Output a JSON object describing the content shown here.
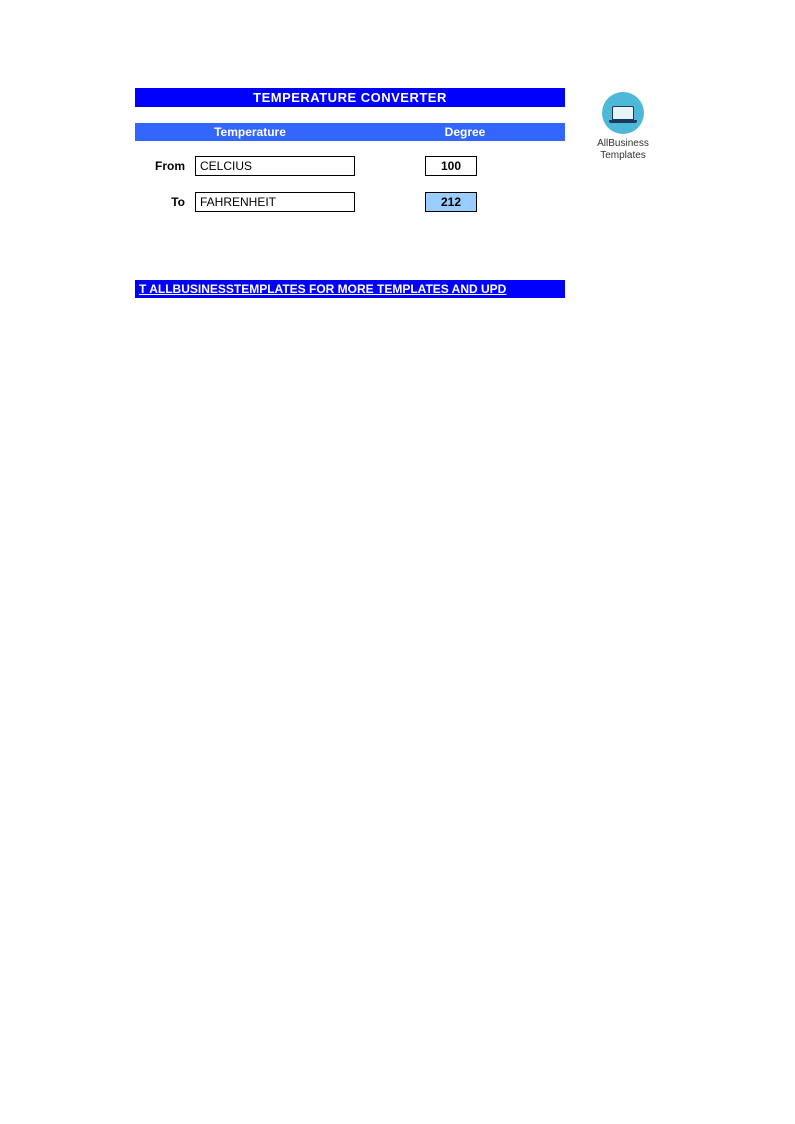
{
  "title": "TEMPERATURE CONVERTER",
  "headers": {
    "temperature": "Temperature",
    "degree": "Degree"
  },
  "rows": {
    "from": {
      "label": "From",
      "unit": "CELCIUS",
      "value": "100"
    },
    "to": {
      "label": "To",
      "unit": "FAHRENHEIT",
      "value": "212"
    }
  },
  "footer_link": "T ALLBUSINESSTEMPLATES FOR MORE TEMPLATES AND UPD",
  "logo": {
    "line1": "AllBusiness",
    "line2": "Templates"
  }
}
